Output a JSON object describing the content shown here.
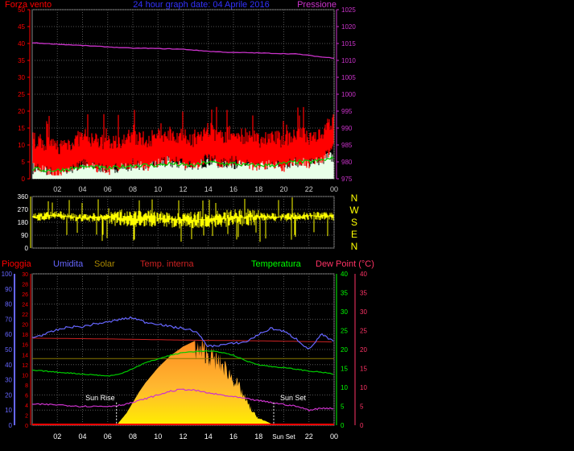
{
  "chart_data": [
    {
      "type": "line",
      "title": "24 hour graph date: 04 Aprile 2016",
      "left_label": "Forza vento",
      "right_label": "Pressione",
      "ylim_left": [
        0,
        50
      ],
      "ylim_right": [
        975,
        1025
      ],
      "y_ticks_left": [
        0,
        5,
        10,
        15,
        20,
        25,
        30,
        35,
        40,
        45,
        50
      ],
      "y_ticks_right": [
        975,
        980,
        985,
        990,
        995,
        1000,
        1005,
        1010,
        1015,
        1020,
        1025
      ],
      "x_ticks": [
        "02",
        "04",
        "06",
        "08",
        "10",
        "12",
        "14",
        "16",
        "18",
        "20",
        "22",
        "00"
      ],
      "grid": true,
      "colors": {
        "wind": "#ff0000",
        "avg": "#00cc00",
        "gust_fill": "#e8ffe8",
        "pressure": "#cc33cc",
        "axis": "#ffff00"
      },
      "series": [
        {
          "key": "pressure",
          "x": [
            0,
            1,
            2,
            3,
            4,
            5,
            6,
            7,
            8,
            9,
            10,
            11,
            12,
            13,
            14,
            15,
            16,
            17,
            18,
            19,
            20,
            21,
            22,
            23,
            24
          ],
          "values": [
            1015.2,
            1015.0,
            1014.8,
            1014.6,
            1014.4,
            1014.2,
            1014.0,
            1013.8,
            1013.6,
            1013.6,
            1013.5,
            1013.4,
            1013.3,
            1013.0,
            1012.7,
            1012.5,
            1012.3,
            1012.3,
            1012.2,
            1012.1,
            1012.0,
            1011.9,
            1011.5,
            1011.0,
            1010.7
          ]
        },
        {
          "key": "wind",
          "x": [
            0,
            1,
            2,
            3,
            4,
            5,
            6,
            7,
            8,
            9,
            10,
            11,
            12,
            13,
            14,
            15,
            16,
            17,
            18,
            19,
            20,
            21,
            22,
            23,
            24
          ],
          "values": [
            9,
            8,
            7,
            8,
            10,
            9,
            8,
            9,
            10,
            9,
            10,
            11,
            10,
            9,
            12,
            10,
            11,
            10,
            9,
            10,
            9,
            11,
            10,
            11,
            15
          ]
        },
        {
          "key": "avg",
          "x": [
            0,
            1,
            2,
            3,
            4,
            5,
            6,
            7,
            8,
            9,
            10,
            11,
            12,
            13,
            14,
            15,
            16,
            17,
            18,
            19,
            20,
            21,
            22,
            23,
            24
          ],
          "values": [
            3,
            2.5,
            2.5,
            3,
            3.5,
            3.5,
            3,
            3.5,
            4,
            4,
            4,
            4.5,
            4,
            4,
            5,
            4.5,
            4.5,
            4,
            4,
            4,
            4.5,
            5,
            5,
            5.5,
            6
          ]
        }
      ]
    },
    {
      "type": "line",
      "ylim": [
        0,
        360
      ],
      "y_ticks": [
        0,
        90,
        180,
        270,
        360
      ],
      "right_labels": [
        "N",
        "W",
        "S",
        "E",
        "N"
      ],
      "colors": {
        "dir": "#ffff00"
      },
      "series": [
        {
          "key": "direction",
          "x": [
            0,
            2,
            4,
            6,
            8,
            10,
            12,
            14,
            16,
            18,
            20,
            22,
            24
          ],
          "values": [
            215,
            230,
            210,
            220,
            200,
            210,
            195,
            200,
            210,
            220,
            215,
            225,
            220
          ]
        }
      ]
    },
    {
      "type": "area",
      "labels": {
        "rain": "Pioggia",
        "humidity": "Umidita",
        "solar": "Solar",
        "temp_int": "Temp. interna",
        "temp": "Temperatura",
        "dew": "Dew Point (°C)"
      },
      "annotations": {
        "sunrise": "Sun Rise",
        "sunset": "Sun Set"
      },
      "sunrise_hour": 6.7,
      "sunset_hour": 19.2,
      "ylim_humidity": [
        0,
        100
      ],
      "y_ticks_humidity": [
        0,
        10,
        20,
        30,
        40,
        50,
        60,
        70,
        80,
        90,
        100
      ],
      "ylim_rain": [
        0,
        30
      ],
      "y_ticks_rain": [
        0,
        2,
        4,
        6,
        8,
        10,
        12,
        14,
        16,
        18,
        20,
        22,
        24,
        26,
        28,
        30
      ],
      "ylim_temp": [
        0,
        40
      ],
      "y_ticks_temp": [
        0,
        5,
        10,
        15,
        20,
        25,
        30,
        35,
        40
      ],
      "y_ticks_dew": [
        0,
        5,
        10,
        15,
        20,
        25,
        30,
        35,
        40
      ],
      "x_ticks": [
        "02",
        "04",
        "06",
        "08",
        "10",
        "12",
        "14",
        "16",
        "18",
        "Sun Set",
        "22",
        "00"
      ],
      "grid": true,
      "colors": {
        "rain": "#ff0000",
        "humidity": "#6666ff",
        "solar": "#ffb020",
        "temp_int": "#cc2222",
        "temp": "#00cc00",
        "dew": "#cc33cc",
        "axis_left": "#6666ff",
        "axis_rain": "#ff0000",
        "axis_temp": "#00ff00",
        "axis_dew": "#ff3366"
      },
      "series": [
        {
          "key": "humidity",
          "x": [
            0,
            1,
            2,
            3,
            4,
            5,
            6,
            7,
            8,
            9,
            10,
            11,
            12,
            13,
            14,
            15,
            16,
            17,
            18,
            19,
            20,
            21,
            22,
            23,
            24
          ],
          "values": [
            58,
            60,
            63,
            65,
            65,
            67,
            68,
            70,
            71,
            68,
            67,
            65,
            64,
            62,
            52,
            53,
            54,
            55,
            60,
            64,
            62,
            57,
            50,
            60,
            55
          ]
        },
        {
          "key": "solar",
          "x": [
            6.7,
            7,
            7.5,
            8,
            8.5,
            9,
            9.5,
            10,
            10.5,
            11,
            11.5,
            12,
            12.5,
            13,
            13.3,
            13.6,
            14,
            14.5,
            15,
            15.5,
            16,
            16.5,
            17,
            17.5,
            18,
            18.5,
            19,
            19.2
          ],
          "values": [
            0,
            3,
            8,
            15,
            22,
            28,
            33,
            38,
            42,
            46,
            49,
            52,
            54,
            56,
            54,
            55,
            52,
            48,
            45,
            40,
            34,
            27,
            18,
            10,
            5,
            3,
            1,
            0
          ]
        },
        {
          "key": "temp_int",
          "x": [
            0,
            6,
            12,
            18,
            24
          ],
          "values": [
            23,
            22.8,
            22.5,
            22.3,
            22
          ]
        },
        {
          "key": "temp",
          "x": [
            0,
            1,
            2,
            3,
            4,
            5,
            6,
            7,
            8,
            9,
            10,
            11,
            12,
            13,
            14,
            15,
            16,
            17,
            18,
            19,
            20,
            21,
            22,
            23,
            24
          ],
          "values": [
            14.5,
            14.3,
            14,
            13.8,
            13.5,
            13.3,
            13,
            13.5,
            15,
            16.5,
            17.5,
            18.5,
            19.2,
            19.5,
            19.6,
            19.3,
            18.5,
            17,
            16,
            15.5,
            15.2,
            14.8,
            14.3,
            14,
            13.5
          ]
        },
        {
          "key": "dew",
          "x": [
            0,
            1,
            2,
            3,
            4,
            5,
            6,
            7,
            8,
            9,
            10,
            11,
            12,
            13,
            14,
            15,
            16,
            17,
            18,
            19,
            20,
            21,
            22,
            23,
            24
          ],
          "values": [
            5.5,
            5.5,
            5.4,
            5.2,
            5,
            5,
            5,
            5.3,
            6,
            7,
            8,
            9,
            9.5,
            9.2,
            8.5,
            8,
            7.5,
            7,
            6.5,
            6,
            5.5,
            5,
            4,
            4.5,
            4.5
          ]
        },
        {
          "key": "rain",
          "x": [
            0,
            24
          ],
          "values": [
            0,
            0
          ]
        }
      ]
    }
  ]
}
